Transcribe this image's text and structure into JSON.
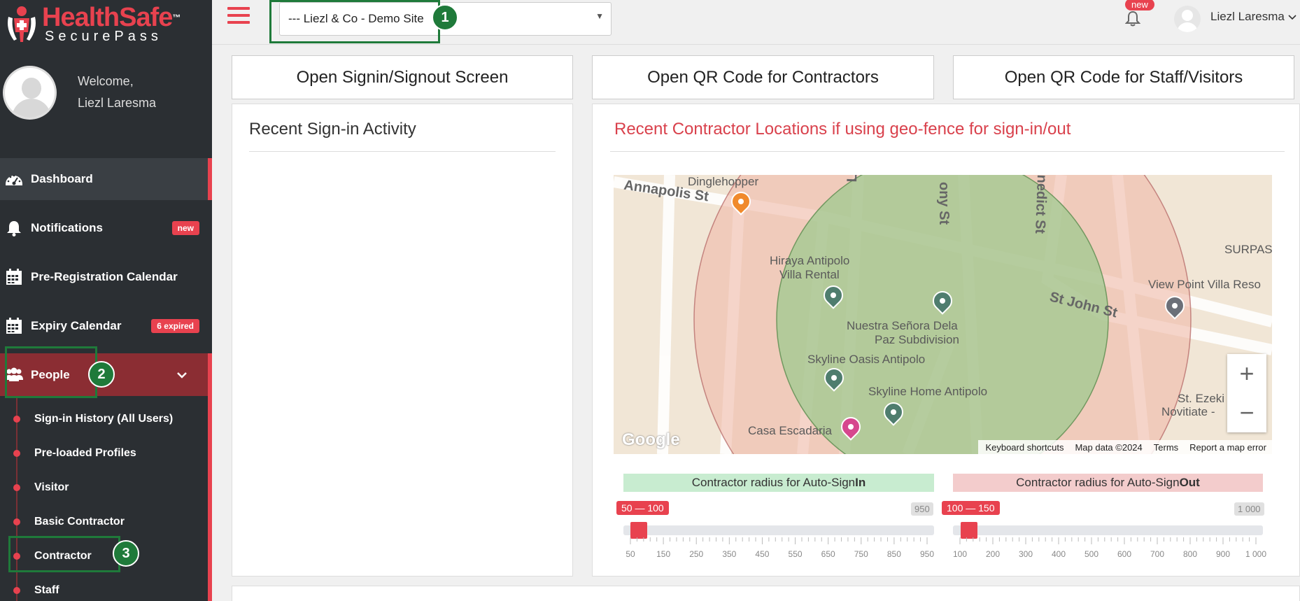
{
  "brand": {
    "name_part1": "Health",
    "name_part2": "Safe",
    "tm": "™",
    "subtitle": "SecurePass",
    "accent": "#e8424f"
  },
  "profile": {
    "welcome": "Welcome,",
    "name": "Liezl Laresma"
  },
  "nav": {
    "dashboard": "Dashboard",
    "notifications": "Notifications",
    "notifications_badge": "new",
    "prereg": "Pre-Registration Calendar",
    "expiry": "Expiry Calendar",
    "expiry_badge": "6 expired",
    "people": "People"
  },
  "subnav": [
    "Sign-in History (All Users)",
    "Pre-loaded Profiles",
    "Visitor",
    "Basic Contractor",
    "Contractor",
    "Staff"
  ],
  "topbar": {
    "site": "--- Liezl & Co - Demo Site",
    "new_badge": "new",
    "user": "Liezl Laresma"
  },
  "markers": {
    "m1": "1",
    "m2": "2",
    "m3": "3"
  },
  "buttons": {
    "signin": "Open Signin/Signout Screen",
    "qr_contractors": "Open QR Code for Contractors",
    "qr_staff": "Open QR Code for Staff/Visitors"
  },
  "recent_activity": {
    "title": "Recent Sign-in Activity"
  },
  "locations": {
    "title": "Recent Contractor Locations if using geo-fence for sign-in/out"
  },
  "map": {
    "places": [
      "Dinglehopper",
      "Hiraya Antipolo",
      "Villa Rental",
      "Nuestra Señora Dela",
      "Paz Subdivision",
      "Skyline Oasis Antipolo",
      "Skyline Home Antipolo",
      "Casa Escadaria",
      "View Point Villa Reso",
      "SURPAS",
      "St. Ezeki",
      "Novitiate -"
    ],
    "streets": [
      "Annapolis St",
      "Libra S",
      "ony St",
      "nedict St",
      "St John St"
    ],
    "google": "Google",
    "footer": [
      "Keyboard shortcuts",
      "Map data ©2024",
      "Terms",
      "Report a map error"
    ]
  },
  "sliders": {
    "signin_label_pre": "Contractor radius for Auto-Sign",
    "signin_label_bold": "In",
    "signout_label_pre": "Contractor radius for Auto-Sign",
    "signout_label_bold": "Out",
    "signin_range": "50 — 100",
    "signin_max": "950",
    "signout_range": "100 — 150",
    "signout_max": "1 000",
    "signin_ticks": [
      "50",
      "150",
      "250",
      "350",
      "450",
      "550",
      "650",
      "750",
      "850",
      "950"
    ],
    "signout_ticks": [
      "100",
      "200",
      "300",
      "400",
      "500",
      "600",
      "700",
      "800",
      "900",
      "1 000"
    ],
    "signin_min_value": 50,
    "signin_low": 50,
    "signin_high": 100,
    "signin_max_value": 950,
    "signout_min_value": 100,
    "signout_low": 100,
    "signout_high": 150,
    "signout_max_value": 1000,
    "signin_color": "#c8ecd0",
    "signout_color": "#f3cccc"
  }
}
